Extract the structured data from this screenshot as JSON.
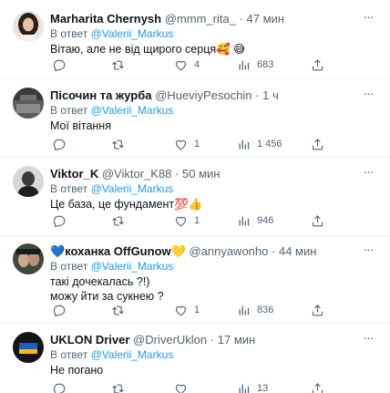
{
  "tweets": [
    {
      "display_name": "Marharita Chernysh",
      "handle": "@mmm_rita_",
      "separator": "·",
      "time": "47 мин",
      "reply_prefix": "В ответ",
      "reply_mention": "@Valerii_Markus",
      "lines": [
        "Вітаю, але не від щирого серця🥰 😅"
      ],
      "likes": "4",
      "views": "683"
    },
    {
      "display_name": "Пісочин та журба",
      "handle": "@HueviyPesochin",
      "separator": "·",
      "time": "1 ч",
      "reply_prefix": "В ответ",
      "reply_mention": "@Valerii_Markus",
      "lines": [
        "Мої вітання"
      ],
      "likes": "1",
      "views": "1 456"
    },
    {
      "display_name": "Viktor_K",
      "handle": "@Viktor_K88",
      "separator": "·",
      "time": "50 мин",
      "reply_prefix": "В ответ",
      "reply_mention": "@Valerii_Markus",
      "lines": [
        "Це база, це фундамент💯👍"
      ],
      "likes": "1",
      "views": "946"
    },
    {
      "display_name_prefix": "💙",
      "display_name": "коханка OffGunow",
      "display_name_suffix": "💛",
      "handle": "@annyawonho",
      "separator": "·",
      "time": "44 мин",
      "reply_prefix": "В ответ",
      "reply_mention": "@Valerii_Markus",
      "lines": [
        "такі дочекалась ?!)",
        "можу йти за сукнею ?"
      ],
      "likes": "1",
      "views": "836"
    },
    {
      "display_name": "UKLON Driver",
      "handle": "@DriverUklon",
      "separator": "·",
      "time": "17 мин",
      "reply_prefix": "В ответ",
      "reply_mention": "@Valerii_Markus",
      "lines": [
        "Не погано"
      ],
      "likes": "",
      "views": "13"
    }
  ],
  "more_label": "···",
  "colors": {
    "accent": "#1d9bf0",
    "secondary_text": "#536471",
    "primary_text": "#0f1419",
    "divider": "#eff3f4"
  },
  "icons": {
    "reply": "reply-icon",
    "retweet": "retweet-icon",
    "like": "heart-icon",
    "views": "views-icon",
    "share": "share-icon",
    "more": "more-icon"
  }
}
